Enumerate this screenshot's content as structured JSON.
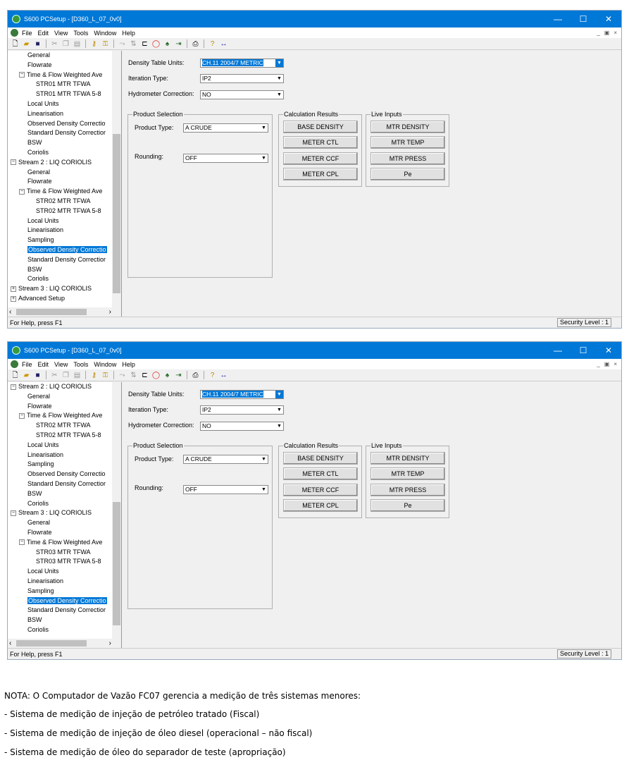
{
  "window": {
    "title": "S600 PCSetup  - [D360_L_07_0v0]",
    "controls": [
      "—",
      "☐",
      "✕"
    ]
  },
  "menu": [
    "File",
    "Edit",
    "View",
    "Tools",
    "Window",
    "Help"
  ],
  "form": {
    "density_units_label": "Density Table Units:",
    "density_units_value": "CH.11 2004/7 METRIC",
    "iteration_label": "Iteration Type:",
    "iteration_value": "IP2",
    "hydrometer_label": "Hydrometer Correction:",
    "hydrometer_value": "NO",
    "product_group": "Product Selection",
    "product_type_label": "Product Type:",
    "product_type_value": "A CRUDE",
    "rounding_label": "Rounding:",
    "rounding_value": "OFF",
    "calc_group": "Calculation Results",
    "calc_buttons": [
      "BASE DENSITY",
      "METER CTL",
      "METER CCF",
      "METER CPL"
    ],
    "live_group": "Live Inputs",
    "live_buttons": [
      "MTR DENSITY",
      "MTR TEMP",
      "MTR PRESS",
      "Pe"
    ]
  },
  "status": {
    "help": "For Help, press F1",
    "security": "Security Level : 1"
  },
  "tree1": [
    {
      "t": "General",
      "indent": 2
    },
    {
      "t": "Flowrate",
      "indent": 2
    },
    {
      "t": "Time & Flow Weighted Ave",
      "indent": 1,
      "pm": "−"
    },
    {
      "t": "STR01 MTR TFWA",
      "indent": 3
    },
    {
      "t": "STR01 MTR TFWA 5-8",
      "indent": 3
    },
    {
      "t": "Local Units",
      "indent": 2
    },
    {
      "t": "Linearisation",
      "indent": 2
    },
    {
      "t": "Observed Density Correctio",
      "indent": 2
    },
    {
      "t": "Standard Density Correctior",
      "indent": 2
    },
    {
      "t": "BSW",
      "indent": 2
    },
    {
      "t": "Coriolis",
      "indent": 2
    },
    {
      "t": "Stream 2 : LIQ CORIOLIS",
      "indent": 0,
      "pm": "−"
    },
    {
      "t": "General",
      "indent": 2
    },
    {
      "t": "Flowrate",
      "indent": 2
    },
    {
      "t": "Time & Flow Weighted Ave",
      "indent": 1,
      "pm": "−"
    },
    {
      "t": "STR02 MTR TFWA",
      "indent": 3
    },
    {
      "t": "STR02 MTR TFWA 5-8",
      "indent": 3
    },
    {
      "t": "Local Units",
      "indent": 2
    },
    {
      "t": "Linearisation",
      "indent": 2
    },
    {
      "t": "Sampling",
      "indent": 2
    },
    {
      "t": "Observed Density Correctio",
      "indent": 2,
      "sel": true
    },
    {
      "t": "Standard Density Correctior",
      "indent": 2
    },
    {
      "t": "BSW",
      "indent": 2
    },
    {
      "t": "Coriolis",
      "indent": 2
    },
    {
      "t": "Stream 3 : LIQ CORIOLIS",
      "indent": 0,
      "pm": "+"
    },
    {
      "t": "Advanced Setup",
      "indent": 0,
      "pm": "+"
    }
  ],
  "tree2": [
    {
      "t": "Stream 2 : LIQ CORIOLIS",
      "indent": 0,
      "pm": "−"
    },
    {
      "t": "General",
      "indent": 2
    },
    {
      "t": "Flowrate",
      "indent": 2
    },
    {
      "t": "Time & Flow Weighted Ave",
      "indent": 1,
      "pm": "−"
    },
    {
      "t": "STR02 MTR TFWA",
      "indent": 3
    },
    {
      "t": "STR02 MTR TFWA 5-8",
      "indent": 3
    },
    {
      "t": "Local Units",
      "indent": 2
    },
    {
      "t": "Linearisation",
      "indent": 2
    },
    {
      "t": "Sampling",
      "indent": 2
    },
    {
      "t": "Observed Density Correctio",
      "indent": 2
    },
    {
      "t": "Standard Density Correctior",
      "indent": 2
    },
    {
      "t": "BSW",
      "indent": 2
    },
    {
      "t": "Coriolis",
      "indent": 2
    },
    {
      "t": "Stream 3 : LIQ CORIOLIS",
      "indent": 0,
      "pm": "−"
    },
    {
      "t": "General",
      "indent": 2
    },
    {
      "t": "Flowrate",
      "indent": 2
    },
    {
      "t": "Time & Flow Weighted Ave",
      "indent": 1,
      "pm": "−"
    },
    {
      "t": "STR03 MTR TFWA",
      "indent": 3
    },
    {
      "t": "STR03 MTR TFWA 5-8",
      "indent": 3
    },
    {
      "t": "Local Units",
      "indent": 2
    },
    {
      "t": "Linearisation",
      "indent": 2
    },
    {
      "t": "Sampling",
      "indent": 2
    },
    {
      "t": "Observed Density Correctio",
      "indent": 2,
      "sel": true
    },
    {
      "t": "Standard Density Correctior",
      "indent": 2
    },
    {
      "t": "BSW",
      "indent": 2
    },
    {
      "t": "Coriolis",
      "indent": 2
    }
  ],
  "note": {
    "l1": "NOTA: O Computador de Vazão FC07 gerencia a medição de três sistemas menores:",
    "l2": "- Sistema de medição de injeção de petróleo tratado (Fiscal)",
    "l3": "- Sistema de medição de injeção de óleo diesel (operacional – não fiscal)",
    "l4": "- Sistema de medição de óleo do separador de teste (apropriação)"
  }
}
